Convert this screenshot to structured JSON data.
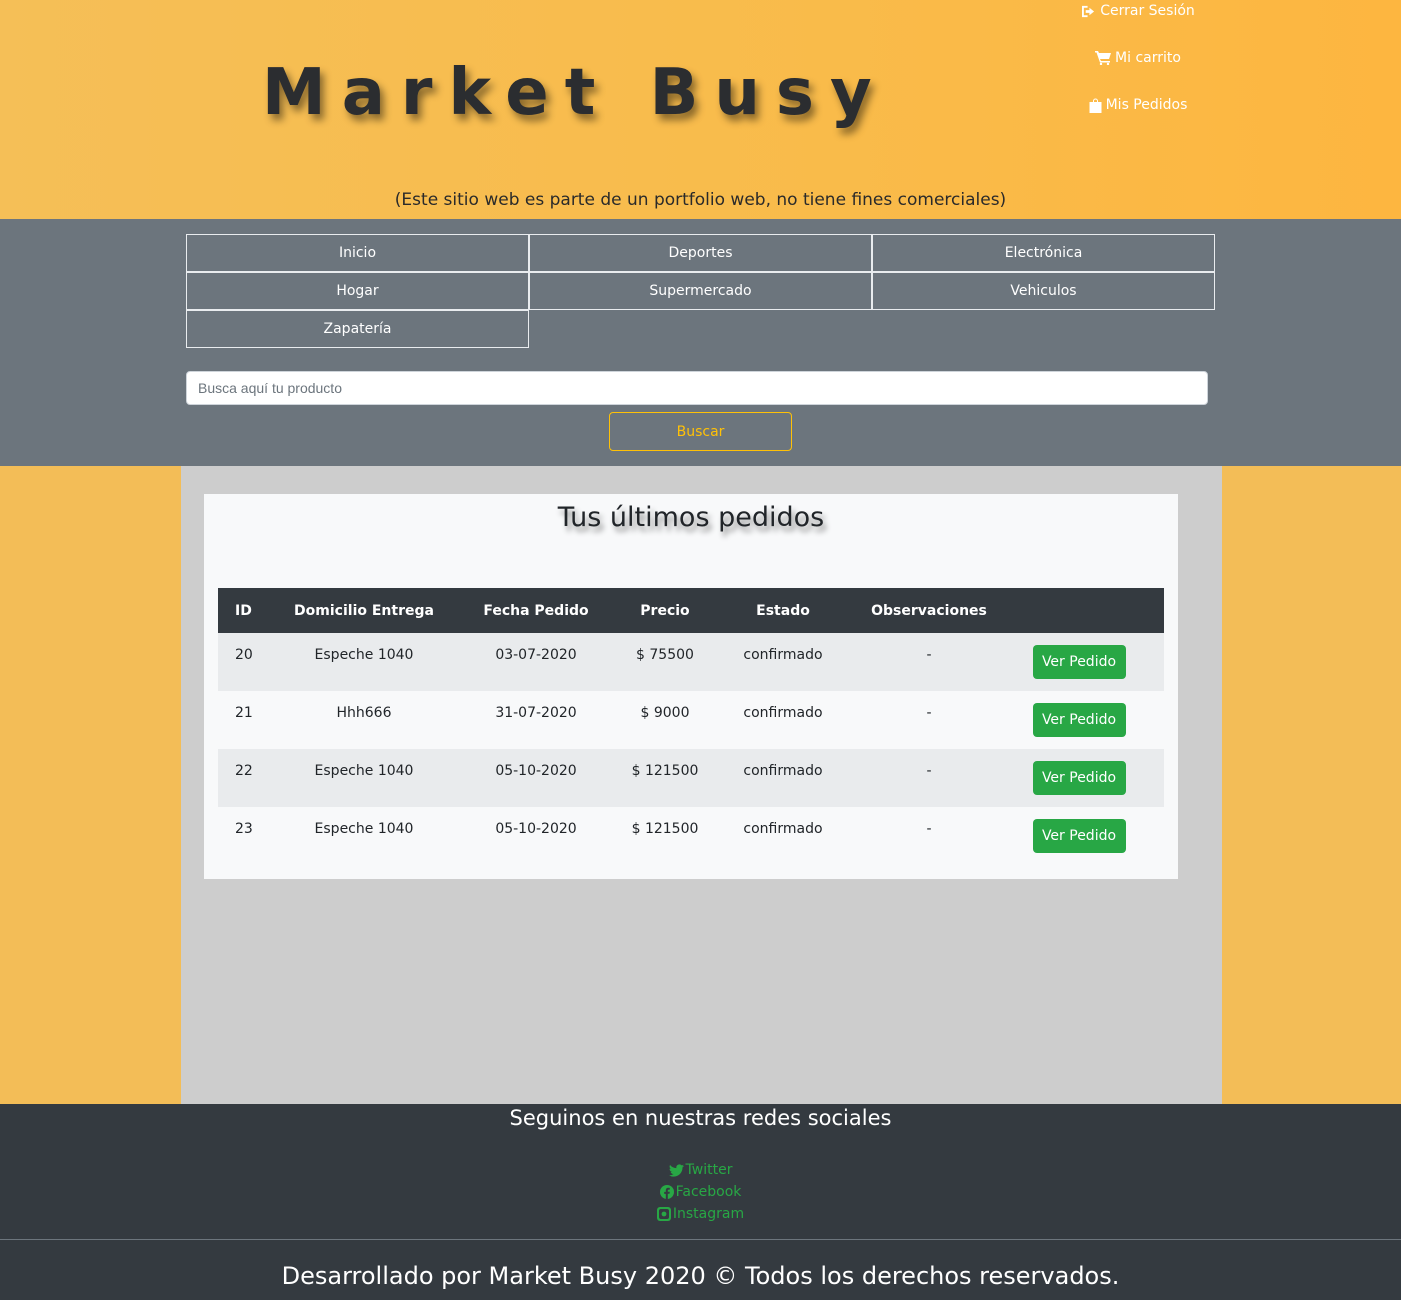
{
  "header": {
    "brand": "Market Busy",
    "disclaimer": "(Este sitio web es parte de un portfolio web, no tiene fines comerciales)",
    "user_links": [
      {
        "label": "Cerrar Sesión",
        "icon": "sign-out-icon"
      },
      {
        "label": "Mi carrito",
        "icon": "cart-icon"
      },
      {
        "label": "Mis Pedidos",
        "icon": "shopping-bag-icon"
      }
    ]
  },
  "nav": {
    "categories": [
      "Inicio",
      "Deportes",
      "Electrónica",
      "Hogar",
      "Supermercado",
      "Vehiculos",
      "Zapatería"
    ],
    "search_placeholder": "Busca aquí tu producto",
    "search_button": "Buscar"
  },
  "orders": {
    "title": "Tus últimos pedidos",
    "columns": [
      "ID",
      "Domicilio Entrega",
      "Fecha Pedido",
      "Precio",
      "Estado",
      "Observaciones",
      ""
    ],
    "rows": [
      {
        "id": "20",
        "address": "Espeche 1040",
        "date": "03-07-2020",
        "price": "$ 75500",
        "status": "confirmado",
        "notes": "-",
        "action": "Ver Pedido"
      },
      {
        "id": "21",
        "address": "Hhh666",
        "date": "31-07-2020",
        "price": "$ 9000",
        "status": "confirmado",
        "notes": "-",
        "action": "Ver Pedido"
      },
      {
        "id": "22",
        "address": "Espeche 1040",
        "date": "05-10-2020",
        "price": "$ 121500",
        "status": "confirmado",
        "notes": "-",
        "action": "Ver Pedido"
      },
      {
        "id": "23",
        "address": "Espeche 1040",
        "date": "05-10-2020",
        "price": "$ 121500",
        "status": "confirmado",
        "notes": "-",
        "action": "Ver Pedido"
      }
    ]
  },
  "footer": {
    "social_title": "Seguinos en nuestras redes sociales",
    "social_links": [
      {
        "label": "Twitter",
        "icon": "twitter-icon"
      },
      {
        "label": "Facebook",
        "icon": "facebook-icon"
      },
      {
        "label": "Instagram",
        "icon": "instagram-icon"
      }
    ],
    "copyright": "Desarrollado por Market Busy 2020 © Todos los derechos reservados."
  },
  "colors": {
    "header_bg": "#f9bb4a",
    "nav_bg": "#6c757d",
    "footer_bg": "#343a40",
    "table_head_bg": "#343a40",
    "action_green": "#28a745",
    "search_yellow": "#ffc107"
  }
}
